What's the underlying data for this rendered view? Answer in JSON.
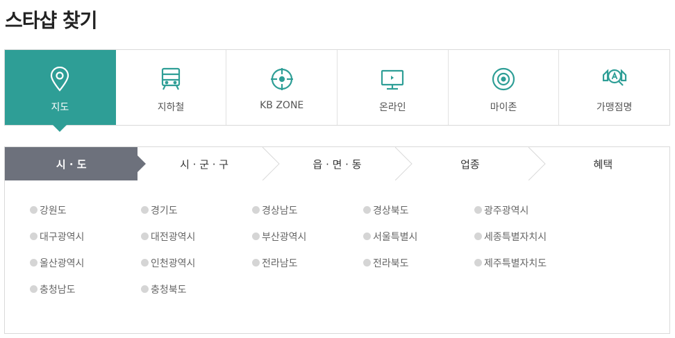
{
  "page": {
    "title": "스타샵 찾기"
  },
  "category_tabs": [
    {
      "label": "지도",
      "icon": "map-pin-icon",
      "active": true
    },
    {
      "label": "지하철",
      "icon": "subway-train-icon",
      "active": false
    },
    {
      "label": "KB ZONE",
      "icon": "crosshair-target-icon",
      "active": false
    },
    {
      "label": "온라인",
      "icon": "monitor-icon",
      "active": false
    },
    {
      "label": "마이존",
      "icon": "location-target-icon",
      "active": false
    },
    {
      "label": "가맹점명",
      "icon": "store-search-icon",
      "active": false
    }
  ],
  "steps": [
    {
      "label": "시 · 도",
      "active": true
    },
    {
      "label": "시 · 군 · 구",
      "active": false
    },
    {
      "label": "읍 · 면 · 동",
      "active": false
    },
    {
      "label": "업종",
      "active": false
    },
    {
      "label": "혜택",
      "active": false
    }
  ],
  "regions": [
    "강원도",
    "경기도",
    "경상남도",
    "경상북도",
    "광주광역시",
    "대구광역시",
    "대전광역시",
    "부산광역시",
    "서울특별시",
    "세종특별자치시",
    "울산광역시",
    "인천광역시",
    "전라남도",
    "전라북도",
    "제주특별자치도",
    "충청남도",
    "충청북도"
  ],
  "colors": {
    "accent": "#2e9e96",
    "step_active": "#6d717c",
    "dot": "#d5d5d5"
  }
}
